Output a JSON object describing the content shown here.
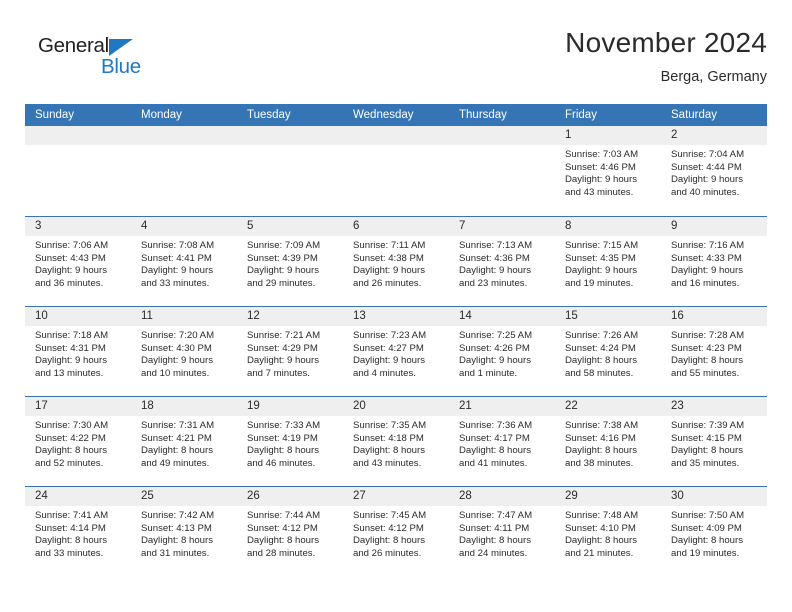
{
  "brand": {
    "name_part1": "General",
    "name_part2": "Blue",
    "triangle_icon": "blue-triangle-icon",
    "colors": {
      "dark": "#231f20",
      "blue": "#2079c4"
    }
  },
  "header": {
    "title": "November 2024",
    "subtitle": "Berga, Germany"
  },
  "colors": {
    "header_blue": "#3575b5",
    "day_number_band": "#efefef",
    "text": "#2b2b2b"
  },
  "calendar": {
    "weekdays": [
      "Sunday",
      "Monday",
      "Tuesday",
      "Wednesday",
      "Thursday",
      "Friday",
      "Saturday"
    ],
    "labels": {
      "sunrise": "Sunrise:",
      "sunset": "Sunset:",
      "daylight": "Daylight:"
    },
    "weeks": [
      [
        {
          "day": "",
          "empty": true
        },
        {
          "day": "",
          "empty": true
        },
        {
          "day": "",
          "empty": true
        },
        {
          "day": "",
          "empty": true
        },
        {
          "day": "",
          "empty": true
        },
        {
          "day": "1",
          "sunrise": "Sunrise: 7:03 AM",
          "sunset": "Sunset: 4:46 PM",
          "daylight_line1": "Daylight: 9 hours",
          "daylight_line2": "and 43 minutes."
        },
        {
          "day": "2",
          "sunrise": "Sunrise: 7:04 AM",
          "sunset": "Sunset: 4:44 PM",
          "daylight_line1": "Daylight: 9 hours",
          "daylight_line2": "and 40 minutes."
        }
      ],
      [
        {
          "day": "3",
          "sunrise": "Sunrise: 7:06 AM",
          "sunset": "Sunset: 4:43 PM",
          "daylight_line1": "Daylight: 9 hours",
          "daylight_line2": "and 36 minutes."
        },
        {
          "day": "4",
          "sunrise": "Sunrise: 7:08 AM",
          "sunset": "Sunset: 4:41 PM",
          "daylight_line1": "Daylight: 9 hours",
          "daylight_line2": "and 33 minutes."
        },
        {
          "day": "5",
          "sunrise": "Sunrise: 7:09 AM",
          "sunset": "Sunset: 4:39 PM",
          "daylight_line1": "Daylight: 9 hours",
          "daylight_line2": "and 29 minutes."
        },
        {
          "day": "6",
          "sunrise": "Sunrise: 7:11 AM",
          "sunset": "Sunset: 4:38 PM",
          "daylight_line1": "Daylight: 9 hours",
          "daylight_line2": "and 26 minutes."
        },
        {
          "day": "7",
          "sunrise": "Sunrise: 7:13 AM",
          "sunset": "Sunset: 4:36 PM",
          "daylight_line1": "Daylight: 9 hours",
          "daylight_line2": "and 23 minutes."
        },
        {
          "day": "8",
          "sunrise": "Sunrise: 7:15 AM",
          "sunset": "Sunset: 4:35 PM",
          "daylight_line1": "Daylight: 9 hours",
          "daylight_line2": "and 19 minutes."
        },
        {
          "day": "9",
          "sunrise": "Sunrise: 7:16 AM",
          "sunset": "Sunset: 4:33 PM",
          "daylight_line1": "Daylight: 9 hours",
          "daylight_line2": "and 16 minutes."
        }
      ],
      [
        {
          "day": "10",
          "sunrise": "Sunrise: 7:18 AM",
          "sunset": "Sunset: 4:31 PM",
          "daylight_line1": "Daylight: 9 hours",
          "daylight_line2": "and 13 minutes."
        },
        {
          "day": "11",
          "sunrise": "Sunrise: 7:20 AM",
          "sunset": "Sunset: 4:30 PM",
          "daylight_line1": "Daylight: 9 hours",
          "daylight_line2": "and 10 minutes."
        },
        {
          "day": "12",
          "sunrise": "Sunrise: 7:21 AM",
          "sunset": "Sunset: 4:29 PM",
          "daylight_line1": "Daylight: 9 hours",
          "daylight_line2": "and 7 minutes."
        },
        {
          "day": "13",
          "sunrise": "Sunrise: 7:23 AM",
          "sunset": "Sunset: 4:27 PM",
          "daylight_line1": "Daylight: 9 hours",
          "daylight_line2": "and 4 minutes."
        },
        {
          "day": "14",
          "sunrise": "Sunrise: 7:25 AM",
          "sunset": "Sunset: 4:26 PM",
          "daylight_line1": "Daylight: 9 hours",
          "daylight_line2": "and 1 minute."
        },
        {
          "day": "15",
          "sunrise": "Sunrise: 7:26 AM",
          "sunset": "Sunset: 4:24 PM",
          "daylight_line1": "Daylight: 8 hours",
          "daylight_line2": "and 58 minutes."
        },
        {
          "day": "16",
          "sunrise": "Sunrise: 7:28 AM",
          "sunset": "Sunset: 4:23 PM",
          "daylight_line1": "Daylight: 8 hours",
          "daylight_line2": "and 55 minutes."
        }
      ],
      [
        {
          "day": "17",
          "sunrise": "Sunrise: 7:30 AM",
          "sunset": "Sunset: 4:22 PM",
          "daylight_line1": "Daylight: 8 hours",
          "daylight_line2": "and 52 minutes."
        },
        {
          "day": "18",
          "sunrise": "Sunrise: 7:31 AM",
          "sunset": "Sunset: 4:21 PM",
          "daylight_line1": "Daylight: 8 hours",
          "daylight_line2": "and 49 minutes."
        },
        {
          "day": "19",
          "sunrise": "Sunrise: 7:33 AM",
          "sunset": "Sunset: 4:19 PM",
          "daylight_line1": "Daylight: 8 hours",
          "daylight_line2": "and 46 minutes."
        },
        {
          "day": "20",
          "sunrise": "Sunrise: 7:35 AM",
          "sunset": "Sunset: 4:18 PM",
          "daylight_line1": "Daylight: 8 hours",
          "daylight_line2": "and 43 minutes."
        },
        {
          "day": "21",
          "sunrise": "Sunrise: 7:36 AM",
          "sunset": "Sunset: 4:17 PM",
          "daylight_line1": "Daylight: 8 hours",
          "daylight_line2": "and 41 minutes."
        },
        {
          "day": "22",
          "sunrise": "Sunrise: 7:38 AM",
          "sunset": "Sunset: 4:16 PM",
          "daylight_line1": "Daylight: 8 hours",
          "daylight_line2": "and 38 minutes."
        },
        {
          "day": "23",
          "sunrise": "Sunrise: 7:39 AM",
          "sunset": "Sunset: 4:15 PM",
          "daylight_line1": "Daylight: 8 hours",
          "daylight_line2": "and 35 minutes."
        }
      ],
      [
        {
          "day": "24",
          "sunrise": "Sunrise: 7:41 AM",
          "sunset": "Sunset: 4:14 PM",
          "daylight_line1": "Daylight: 8 hours",
          "daylight_line2": "and 33 minutes."
        },
        {
          "day": "25",
          "sunrise": "Sunrise: 7:42 AM",
          "sunset": "Sunset: 4:13 PM",
          "daylight_line1": "Daylight: 8 hours",
          "daylight_line2": "and 31 minutes."
        },
        {
          "day": "26",
          "sunrise": "Sunrise: 7:44 AM",
          "sunset": "Sunset: 4:12 PM",
          "daylight_line1": "Daylight: 8 hours",
          "daylight_line2": "and 28 minutes."
        },
        {
          "day": "27",
          "sunrise": "Sunrise: 7:45 AM",
          "sunset": "Sunset: 4:12 PM",
          "daylight_line1": "Daylight: 8 hours",
          "daylight_line2": "and 26 minutes."
        },
        {
          "day": "28",
          "sunrise": "Sunrise: 7:47 AM",
          "sunset": "Sunset: 4:11 PM",
          "daylight_line1": "Daylight: 8 hours",
          "daylight_line2": "and 24 minutes."
        },
        {
          "day": "29",
          "sunrise": "Sunrise: 7:48 AM",
          "sunset": "Sunset: 4:10 PM",
          "daylight_line1": "Daylight: 8 hours",
          "daylight_line2": "and 21 minutes."
        },
        {
          "day": "30",
          "sunrise": "Sunrise: 7:50 AM",
          "sunset": "Sunset: 4:09 PM",
          "daylight_line1": "Daylight: 8 hours",
          "daylight_line2": "and 19 minutes."
        }
      ]
    ]
  }
}
